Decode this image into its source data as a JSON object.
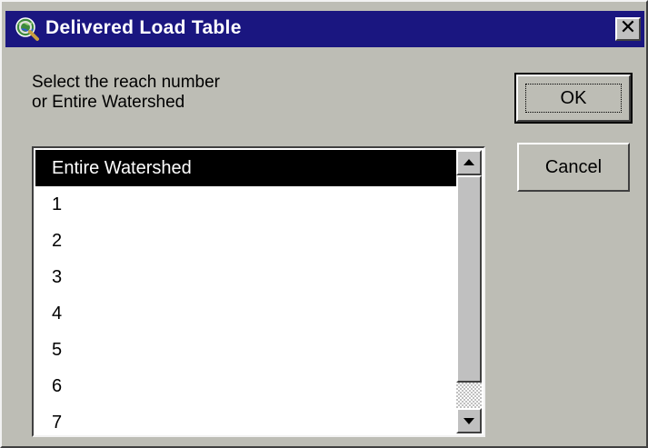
{
  "window": {
    "title": "Delivered Load Table",
    "close_glyph": "✕"
  },
  "dialog": {
    "prompt": "Select the reach number\nor Entire Watershed",
    "ok_label": "OK",
    "cancel_label": "Cancel"
  },
  "list": {
    "items": [
      "Entire Watershed",
      "1",
      "2",
      "3",
      "4",
      "5",
      "6",
      "7"
    ],
    "selected_index": 0
  },
  "icons": {
    "title_icon": "globe-magnifier-icon",
    "scroll_up": "arrow-up-icon",
    "scroll_down": "arrow-down-icon"
  },
  "colors": {
    "titlebar": "#1a1680",
    "selection": "#000000",
    "dialog_bg": "#bdbdb5"
  }
}
